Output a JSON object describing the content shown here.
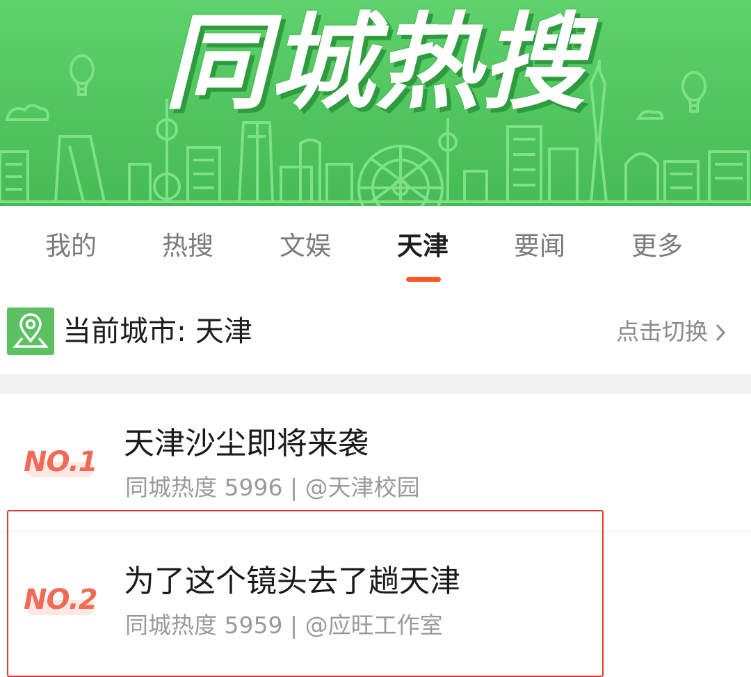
{
  "banner": {
    "title": "同城热搜"
  },
  "tabs": [
    {
      "label": "我的",
      "active": false
    },
    {
      "label": "热搜",
      "active": false
    },
    {
      "label": "文娱",
      "active": false
    },
    {
      "label": "天津",
      "active": true
    },
    {
      "label": "要闻",
      "active": false
    },
    {
      "label": "更多",
      "active": false
    }
  ],
  "city": {
    "label": "当前城市: 天津",
    "switch_label": "点击切换",
    "icon": "location-pin-icon"
  },
  "hot_list": [
    {
      "rank": "NO.1",
      "title": "天津沙尘即将来袭",
      "meta": "同城热度 5996 | @天津校园"
    },
    {
      "rank": "NO.2",
      "title": "为了这个镜头去了趟天津",
      "meta": "同城热度 5959 | @应旺工作室"
    }
  ],
  "colors": {
    "banner_green": "#4fc45c",
    "accent_orange": "#ff5722",
    "rank_red": "#f06a55",
    "highlight_red": "#e53935"
  }
}
